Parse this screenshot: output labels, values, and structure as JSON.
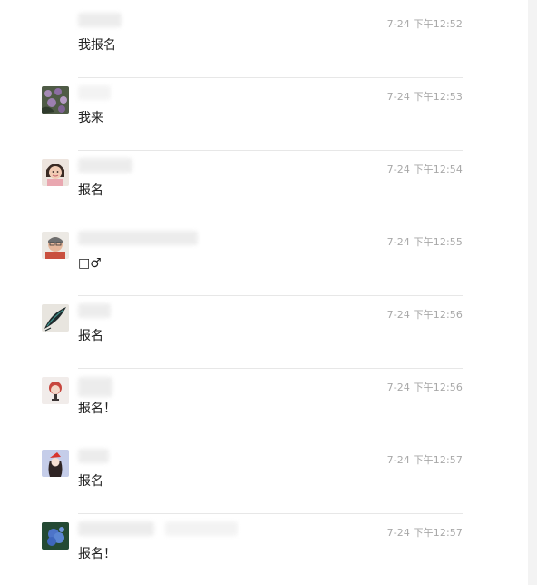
{
  "comments": [
    {
      "time": "7-24 下午12:52",
      "text": "我报名"
    },
    {
      "time": "7-24 下午12:53",
      "text": "我来"
    },
    {
      "time": "7-24 下午12:54",
      "text": "报名"
    },
    {
      "time": "7-24 下午12:55",
      "text": "□♂"
    },
    {
      "time": "7-24 下午12:56",
      "text": "报名"
    },
    {
      "time": "7-24 下午12:56",
      "text": "报名！"
    },
    {
      "time": "7-24 下午12:57",
      "text": "报名"
    },
    {
      "time": "7-24 下午12:57",
      "text": "报名！"
    }
  ]
}
